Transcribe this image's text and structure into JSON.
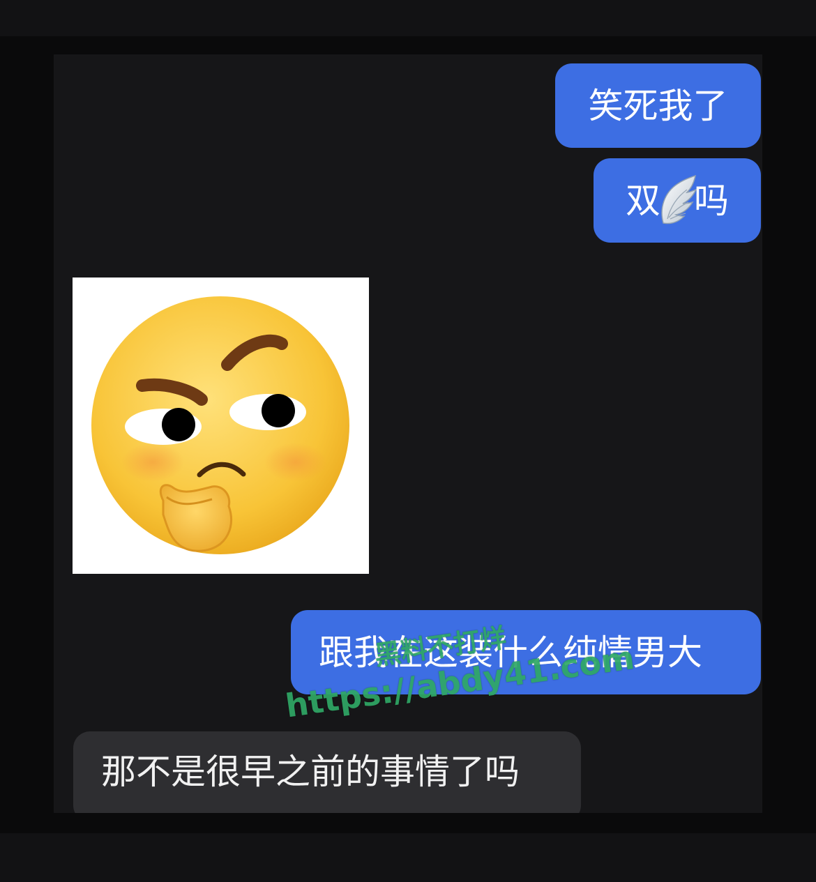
{
  "messages": [
    {
      "side": "sent",
      "text": "笑死我了"
    },
    {
      "side": "sent",
      "text_before": "双",
      "text_after": "吗",
      "inline_icon": "angel-wing-icon"
    },
    {
      "side": "received",
      "type": "sticker",
      "icon": "thinking-face-emoji-icon"
    },
    {
      "side": "sent",
      "text": "跟我在这装什么纯情男大"
    },
    {
      "side": "received",
      "text": "那不是很早之前的事情了吗"
    }
  ],
  "watermark": {
    "line1": "黑料不打烊",
    "line2": "https://abdy41.com",
    "color": "#2fa866"
  },
  "colors": {
    "sent_bubble": "#3d6ee3",
    "received_bubble": "#2e2e31",
    "background": "#161618"
  }
}
